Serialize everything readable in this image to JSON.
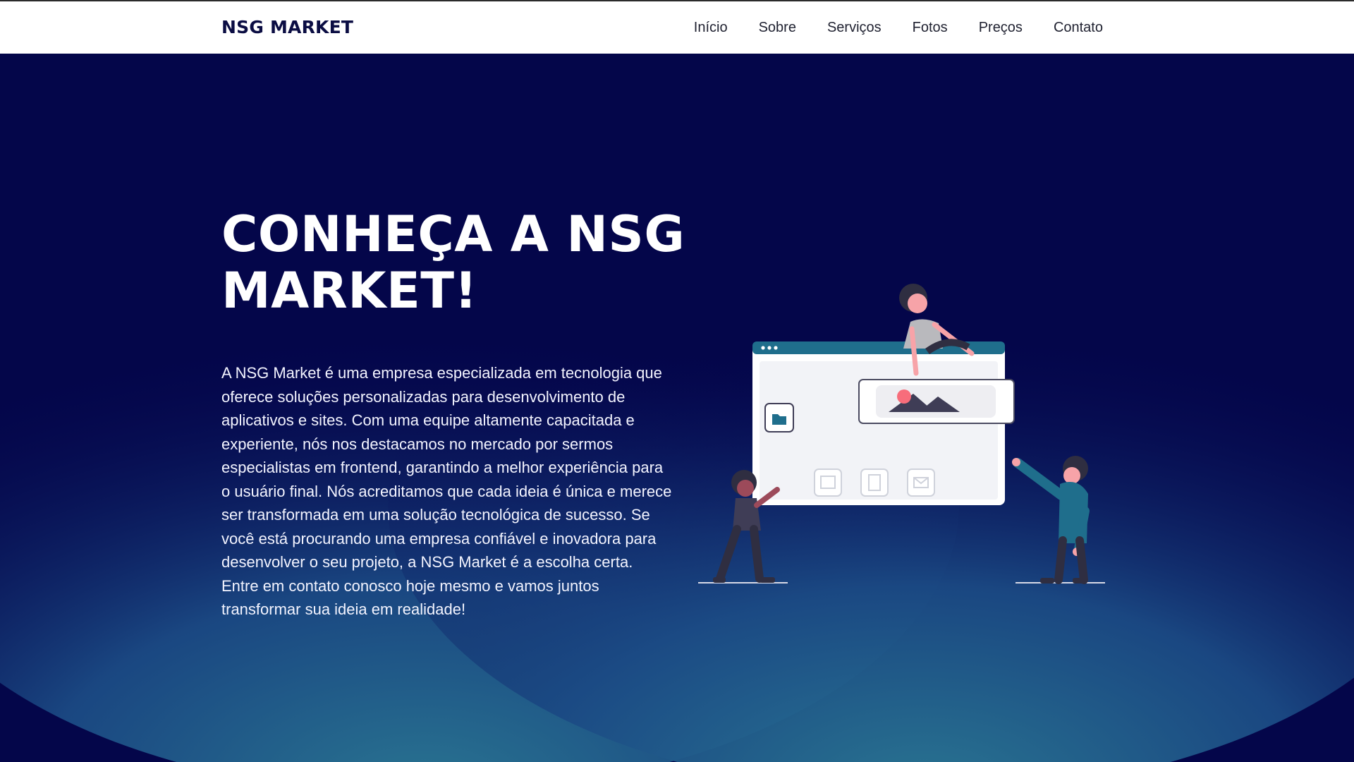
{
  "header": {
    "logo": "NSG MARKET",
    "nav": [
      "Início",
      "Sobre",
      "Serviços",
      "Fotos",
      "Preços",
      "Contato"
    ]
  },
  "hero": {
    "title": "CONHEÇA A NSG MARKET!",
    "description": "A NSG Market é uma empresa especializada em tecnologia que oferece soluções personalizadas para desenvolvimento de aplicativos e sites. Com uma equipe altamente capacitada e experiente, nós nos destacamos no mercado por sermos especialistas em frontend, garantindo a melhor experiência para o usuário final. Nós acreditamos que cada ideia é única e merece ser transformada em uma solução tecnológica de sucesso. Se você está procurando uma empresa confiável e inovadora para desenvolver o seu projeto, a NSG Market é a escolha certa. Entre em contato conosco hoje mesmo e vamos juntos transformar sua ideia em realidade!"
  },
  "illustration": {
    "name": "team-building-website-illustration",
    "icons": [
      "folder-icon",
      "image-icon",
      "document-icon",
      "mail-icon"
    ]
  },
  "colors": {
    "background": "#04064a",
    "accent": "#2a6f8e",
    "header_bg": "#ffffff",
    "text_light": "#ffffff",
    "person_pink": "#f7a3a8",
    "person_teal": "#1f6e8c"
  }
}
